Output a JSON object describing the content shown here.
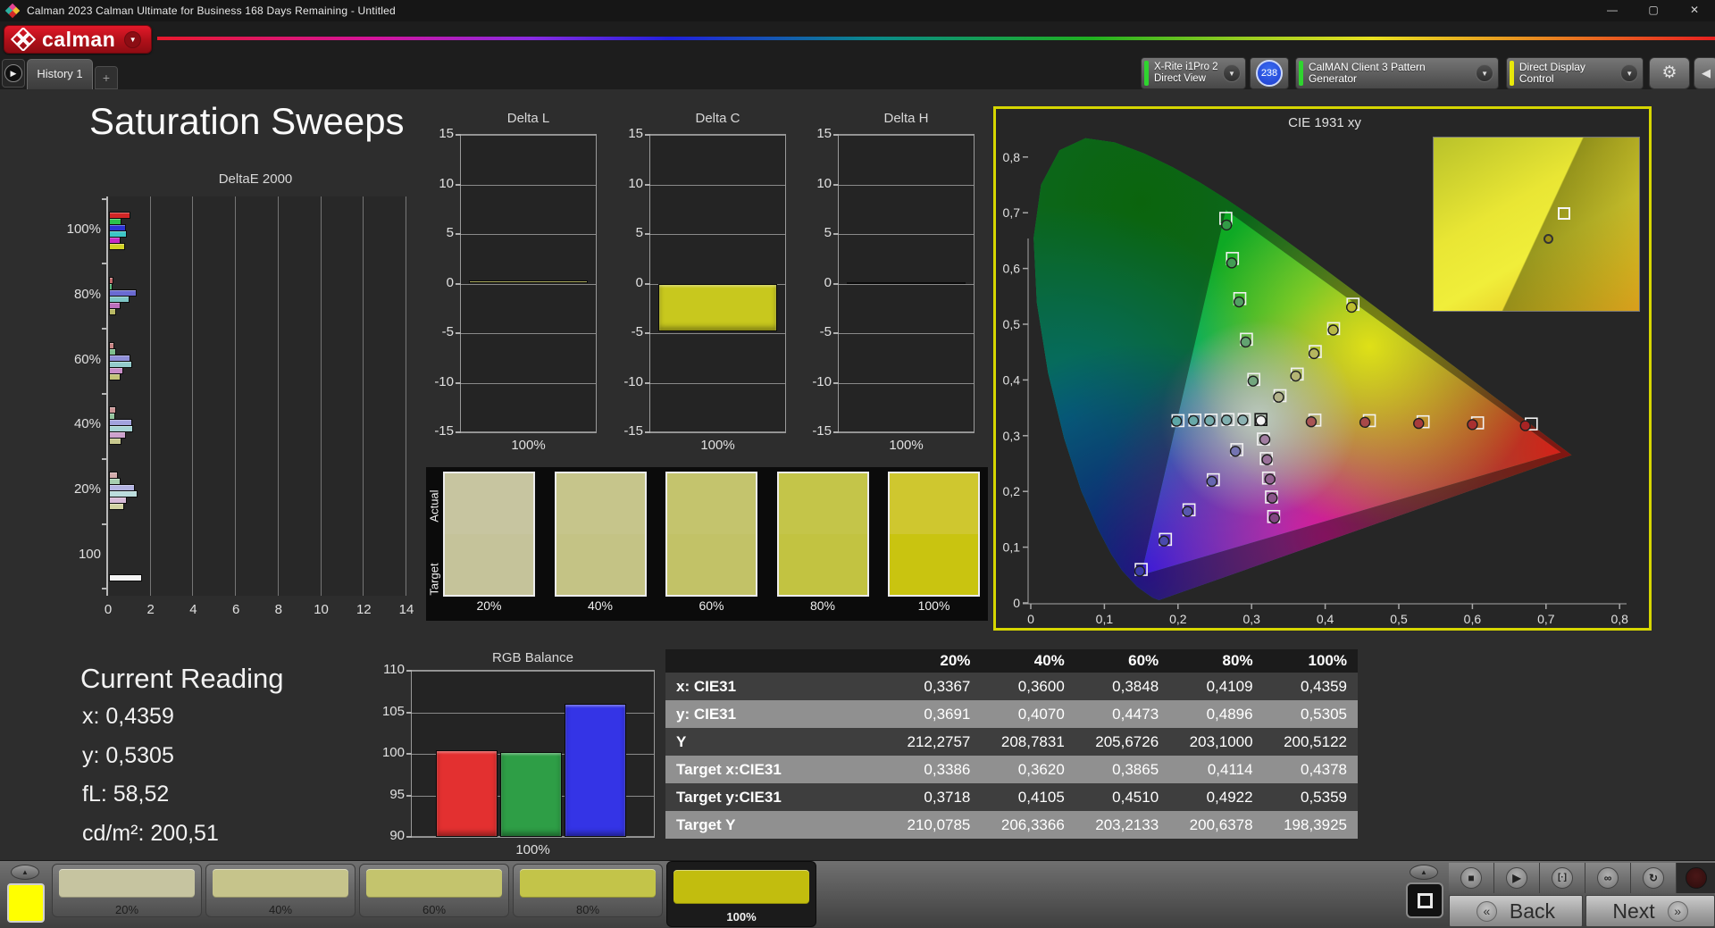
{
  "window": {
    "title": "Calman 2023 Calman Ultimate for Business 168 Days Remaining  - Untitled",
    "controls": {
      "minimize": "—",
      "maximize": "▢",
      "close": "✕"
    }
  },
  "header": {
    "logo_text": "calman"
  },
  "tab_bar": {
    "history_tab": "History 1",
    "add_tab": "+"
  },
  "toolbar": {
    "meter": {
      "line1": "X-Rite i1Pro 2",
      "line2": "Direct View",
      "badge": "238",
      "status_color": "#2fd42f"
    },
    "pattern_generator": {
      "label": "CalMAN Client 3 Pattern Generator",
      "status_color": "#2fd42f"
    },
    "display_control": {
      "label": "Direct Display Control",
      "status_color": "#e8e80a"
    }
  },
  "page": {
    "title": "Saturation Sweeps"
  },
  "chart_data": {
    "deltae2000": {
      "type": "bar",
      "orientation": "horizontal",
      "title": "DeltaE 2000",
      "xlim": [
        0,
        14
      ],
      "x_ticks": [
        0,
        2,
        4,
        6,
        8,
        10,
        12,
        14
      ],
      "groups": [
        {
          "label": "100%",
          "values": [
            1.0,
            0.6,
            0.8,
            0.85,
            0.55,
            0.75
          ],
          "colors": [
            "#d22626",
            "#2cc44c",
            "#2c34d2",
            "#3cc6c6",
            "#c62cc6",
            "#d2d226"
          ]
        },
        {
          "label": "80%",
          "values": [
            0.2,
            0.15,
            1.3,
            0.95,
            0.55,
            0.35
          ],
          "colors": [
            "#c26a6a",
            "#5cb97e",
            "#6a6ad2",
            "#7ec6c6",
            "#bd6fbd",
            "#b9b964"
          ]
        },
        {
          "label": "60%",
          "values": [
            0.25,
            0.35,
            1.0,
            1.1,
            0.65,
            0.55
          ],
          "colors": [
            "#c88484",
            "#7ec08e",
            "#8e8ed8",
            "#93cccc",
            "#c88ec8",
            "#c4c478"
          ]
        },
        {
          "label": "40%",
          "values": [
            0.35,
            0.3,
            1.1,
            1.15,
            0.8,
            0.6
          ],
          "colors": [
            "#cd9898",
            "#93c49d",
            "#a2a2dd",
            "#a7d4d4",
            "#cda2cd",
            "#c8c88e"
          ]
        },
        {
          "label": "20%",
          "values": [
            0.4,
            0.55,
            1.2,
            1.35,
            0.85,
            0.7
          ],
          "colors": [
            "#d3acac",
            "#a7cfaf",
            "#b4b4e2",
            "#bbdddd",
            "#d8bbd8",
            "#d3d3a2"
          ]
        },
        {
          "label": "100",
          "values": [
            1.55
          ],
          "colors": [
            "#f4f4f4"
          ]
        }
      ]
    },
    "delta_l": {
      "type": "bar",
      "title": "Delta L",
      "ylim": [
        -15,
        15
      ],
      "y_ticks": [
        15,
        10,
        5,
        0,
        -5,
        -10,
        -15
      ],
      "xlabel": "100%",
      "baseline": "zero",
      "values": [
        0.35
      ],
      "colors": [
        "#c8c81e"
      ]
    },
    "delta_c": {
      "type": "bar",
      "title": "Delta C",
      "ylim": [
        -15,
        15
      ],
      "y_ticks": [
        15,
        10,
        5,
        0,
        -5,
        -10,
        -15
      ],
      "xlabel": "100%",
      "baseline": "zero",
      "values": [
        -4.8
      ],
      "colors": [
        "#c8c81e"
      ]
    },
    "delta_h": {
      "type": "bar",
      "title": "Delta H",
      "ylim": [
        -15,
        15
      ],
      "y_ticks": [
        15,
        10,
        5,
        0,
        -5,
        -10,
        -15
      ],
      "xlabel": "100%",
      "baseline": "zero",
      "values": [
        0.12
      ],
      "colors": [
        "#c8c81e"
      ]
    },
    "rgb_balance": {
      "type": "bar",
      "title": "RGB Balance",
      "ylim": [
        90,
        110
      ],
      "y_ticks": [
        110,
        105,
        100,
        95,
        90
      ],
      "xlabel": "100%",
      "baseline": "min",
      "categories": [
        "Red",
        "Green",
        "Blue"
      ],
      "values": [
        100.4,
        100.2,
        106.0
      ],
      "colors": [
        "#e33030",
        "#2e9e46",
        "#3434e6"
      ]
    },
    "cie1931": {
      "type": "scatter",
      "title": "CIE 1931 xy",
      "xlim": [
        0,
        0.8
      ],
      "ylim": [
        0,
        0.8
      ],
      "x_tick_labels": [
        "0",
        "0,1",
        "0,2",
        "0,3",
        "0,4",
        "0,5",
        "0,6",
        "0,7",
        "0,8"
      ],
      "y_tick_labels": [
        "0",
        "0,1",
        "0,2",
        "0,3",
        "0,4",
        "0,5",
        "0,6",
        "0,7",
        "0,8"
      ],
      "targets": [
        {
          "x": 0.3127,
          "y": 0.329,
          "outline": "#151515"
        },
        {
          "x": 0.386,
          "y": 0.328
        },
        {
          "x": 0.46,
          "y": 0.327
        },
        {
          "x": 0.533,
          "y": 0.325
        },
        {
          "x": 0.607,
          "y": 0.323
        },
        {
          "x": 0.68,
          "y": 0.321
        },
        {
          "x": 0.303,
          "y": 0.401
        },
        {
          "x": 0.293,
          "y": 0.473
        },
        {
          "x": 0.284,
          "y": 0.546
        },
        {
          "x": 0.274,
          "y": 0.618
        },
        {
          "x": 0.265,
          "y": 0.69
        },
        {
          "x": 0.28,
          "y": 0.275
        },
        {
          "x": 0.248,
          "y": 0.221
        },
        {
          "x": 0.215,
          "y": 0.167
        },
        {
          "x": 0.183,
          "y": 0.114
        },
        {
          "x": 0.15,
          "y": 0.06
        },
        {
          "x": 0.29,
          "y": 0.329
        },
        {
          "x": 0.268,
          "y": 0.329
        },
        {
          "x": 0.245,
          "y": 0.328
        },
        {
          "x": 0.223,
          "y": 0.328
        },
        {
          "x": 0.2,
          "y": 0.327
        },
        {
          "x": 0.316,
          "y": 0.294
        },
        {
          "x": 0.32,
          "y": 0.259
        },
        {
          "x": 0.323,
          "y": 0.224
        },
        {
          "x": 0.327,
          "y": 0.19
        },
        {
          "x": 0.33,
          "y": 0.155
        },
        {
          "x": 0.3386,
          "y": 0.3718
        },
        {
          "x": 0.362,
          "y": 0.4105
        },
        {
          "x": 0.3865,
          "y": 0.451
        },
        {
          "x": 0.4114,
          "y": 0.4922
        },
        {
          "x": 0.4378,
          "y": 0.5359
        }
      ],
      "measured": [
        {
          "x": 0.3127,
          "y": 0.327,
          "color": "#f2f2f2"
        },
        {
          "x": 0.381,
          "y": 0.325,
          "color": "#a85454"
        },
        {
          "x": 0.454,
          "y": 0.324,
          "color": "#a84848"
        },
        {
          "x": 0.527,
          "y": 0.322,
          "color": "#a83c3c"
        },
        {
          "x": 0.6,
          "y": 0.32,
          "color": "#a83030"
        },
        {
          "x": 0.672,
          "y": 0.318,
          "color": "#a82424"
        },
        {
          "x": 0.302,
          "y": 0.398,
          "color": "#72a67e"
        },
        {
          "x": 0.292,
          "y": 0.468,
          "color": "#62a370"
        },
        {
          "x": 0.283,
          "y": 0.54,
          "color": "#52a062"
        },
        {
          "x": 0.273,
          "y": 0.61,
          "color": "#429d54"
        },
        {
          "x": 0.266,
          "y": 0.678,
          "color": "#329a46"
        },
        {
          "x": 0.278,
          "y": 0.272,
          "color": "#7474b2"
        },
        {
          "x": 0.246,
          "y": 0.218,
          "color": "#6666b0"
        },
        {
          "x": 0.213,
          "y": 0.164,
          "color": "#5858ae"
        },
        {
          "x": 0.181,
          "y": 0.111,
          "color": "#4a4aac"
        },
        {
          "x": 0.148,
          "y": 0.057,
          "color": "#3c3caa"
        },
        {
          "x": 0.288,
          "y": 0.328,
          "color": "#8cb2b2"
        },
        {
          "x": 0.266,
          "y": 0.328,
          "color": "#80afaf"
        },
        {
          "x": 0.243,
          "y": 0.327,
          "color": "#74acac"
        },
        {
          "x": 0.221,
          "y": 0.327,
          "color": "#68a9a9"
        },
        {
          "x": 0.198,
          "y": 0.326,
          "color": "#5ca6a6"
        },
        {
          "x": 0.318,
          "y": 0.293,
          "color": "#a27ea2"
        },
        {
          "x": 0.321,
          "y": 0.257,
          "color": "#9a709a"
        },
        {
          "x": 0.325,
          "y": 0.222,
          "color": "#926292"
        },
        {
          "x": 0.328,
          "y": 0.188,
          "color": "#8a548a"
        },
        {
          "x": 0.331,
          "y": 0.152,
          "color": "#824682"
        },
        {
          "x": 0.3367,
          "y": 0.3691,
          "color": "#b2b28a"
        },
        {
          "x": 0.36,
          "y": 0.407,
          "color": "#b4b474"
        },
        {
          "x": 0.3848,
          "y": 0.4473,
          "color": "#b6b65e"
        },
        {
          "x": 0.4109,
          "y": 0.4896,
          "color": "#b8b846"
        },
        {
          "x": 0.4359,
          "y": 0.5305,
          "color": "#bcbc2e"
        }
      ],
      "inset_markers": {
        "square": [
          0.6,
          0.4
        ],
        "circle": [
          0.53,
          0.55
        ]
      }
    }
  },
  "swatch_panel": {
    "row_labels": [
      "Actual",
      "Target"
    ],
    "swatches": [
      {
        "label": "20%",
        "actual": "#c7c5a0",
        "target": "#c5c39a"
      },
      {
        "label": "40%",
        "actual": "#c6c58b",
        "target": "#c4c385"
      },
      {
        "label": "60%",
        "actual": "#c4c46d",
        "target": "#c2c267"
      },
      {
        "label": "80%",
        "actual": "#c4c549",
        "target": "#c2c341"
      },
      {
        "label": "100%",
        "actual": "#cfc72f",
        "target": "#c9c410"
      }
    ]
  },
  "current_reading": {
    "title": "Current Reading",
    "items": [
      {
        "label": "x:",
        "value": "0,4359"
      },
      {
        "label": "y:",
        "value": "0,5305"
      },
      {
        "label": "fL:",
        "value": "58,52"
      },
      {
        "label": "cd/m²:",
        "value": "200,51"
      }
    ]
  },
  "table": {
    "columns": [
      "20%",
      "40%",
      "60%",
      "80%",
      "100%"
    ],
    "rows": [
      {
        "label": "x: CIE31",
        "values": [
          "0,3367",
          "0,3600",
          "0,3848",
          "0,4109",
          "0,4359"
        ]
      },
      {
        "label": "y: CIE31",
        "values": [
          "0,3691",
          "0,4070",
          "0,4473",
          "0,4896",
          "0,5305"
        ]
      },
      {
        "label": "Y",
        "values": [
          "212,2757",
          "208,7831",
          "205,6726",
          "203,1000",
          "200,5122"
        ]
      },
      {
        "label": "Target x:CIE31",
        "values": [
          "0,3386",
          "0,3620",
          "0,3865",
          "0,4114",
          "0,4378"
        ]
      },
      {
        "label": "Target y:CIE31",
        "values": [
          "0,3718",
          "0,4105",
          "0,4510",
          "0,4922",
          "0,5359"
        ]
      },
      {
        "label": "Target Y",
        "values": [
          "210,0785",
          "206,3366",
          "203,2133",
          "200,6378",
          "198,3925"
        ]
      }
    ]
  },
  "bottom_bar": {
    "current_color": "#ffff00",
    "patterns": [
      {
        "label": "20%",
        "color": "#c6c4a0",
        "selected": false
      },
      {
        "label": "40%",
        "color": "#c6c48b",
        "selected": false
      },
      {
        "label": "60%",
        "color": "#c4c46d",
        "selected": false
      },
      {
        "label": "80%",
        "color": "#c3c449",
        "selected": false
      },
      {
        "label": "100%",
        "color": "#c2bd0e",
        "selected": true
      }
    ],
    "back_label": "Back",
    "next_label": "Next"
  }
}
